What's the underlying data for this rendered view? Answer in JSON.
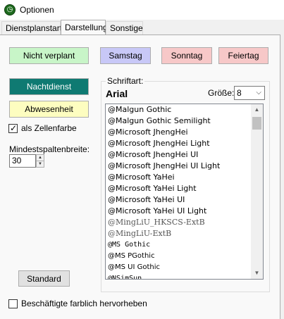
{
  "window": {
    "title": "Optionen",
    "app_icon": "clock-icon"
  },
  "tabs": [
    {
      "label": "Dienstplanstart"
    },
    {
      "label": "Darstellung"
    },
    {
      "label": "Sonstige"
    }
  ],
  "buttons": {
    "nicht_verplant": "Nicht verplant",
    "samstag": "Samstag",
    "sonntag": "Sonntag",
    "feiertag": "Feiertag",
    "nachtdienst": "Nachtdienst",
    "abwesenheit": "Abwesenheit",
    "standard": "Standard"
  },
  "colors": {
    "nicht_verplant": "#c8f5c8",
    "samstag": "#c8c8f7",
    "sonntag": "#f7c8c8",
    "feiertag": "#f7c8c8",
    "nachtdienst": "#0f7a72",
    "abwesenheit": "#fdfdc0"
  },
  "zellenfarbe": {
    "label": "als Zellenfarbe",
    "checked": true
  },
  "mindestspalten": {
    "label": "Mindestspaltenbreite:",
    "value": "30"
  },
  "schriftart": {
    "group_label": "Schriftart:",
    "current_font": "Arial",
    "size_label": "Größe:",
    "size_value": "8",
    "fonts": [
      "@Malgun Gothic",
      "@Malgun Gothic Semilight",
      "@Microsoft JhengHei",
      "@Microsoft JhengHei Light",
      "@Microsoft JhengHei UI",
      "@Microsoft JhengHei UI Light",
      "@Microsoft YaHei",
      "@Microsoft YaHei Light",
      "@Microsoft YaHei UI",
      "@Microsoft YaHei UI Light",
      "@MingLiU_HKSCS-ExtB",
      "@MingLiU-ExtB",
      "@MS Gothic",
      "@MS PGothic",
      "@MS UI Gothic",
      "@NSimSun"
    ]
  },
  "beschaeftigte": {
    "label": "Beschäftigte farblich hervorheben",
    "checked": false
  }
}
